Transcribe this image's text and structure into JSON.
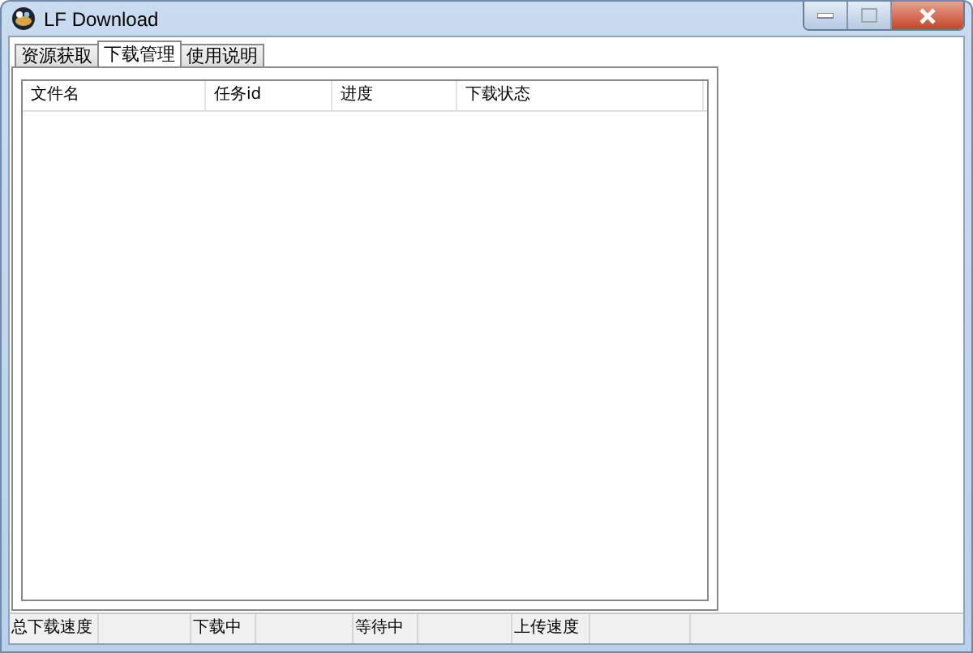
{
  "window": {
    "title": "LF Download"
  },
  "tabs": [
    {
      "label": "资源获取",
      "selected": false
    },
    {
      "label": "下载管理",
      "selected": true
    },
    {
      "label": "使用说明",
      "selected": false
    }
  ],
  "table": {
    "columns": [
      "文件名",
      "任务id",
      "进度",
      "下载状态"
    ]
  },
  "status_bar": [
    "总下载速度",
    "下载中",
    "等待中",
    "上传速度"
  ]
}
